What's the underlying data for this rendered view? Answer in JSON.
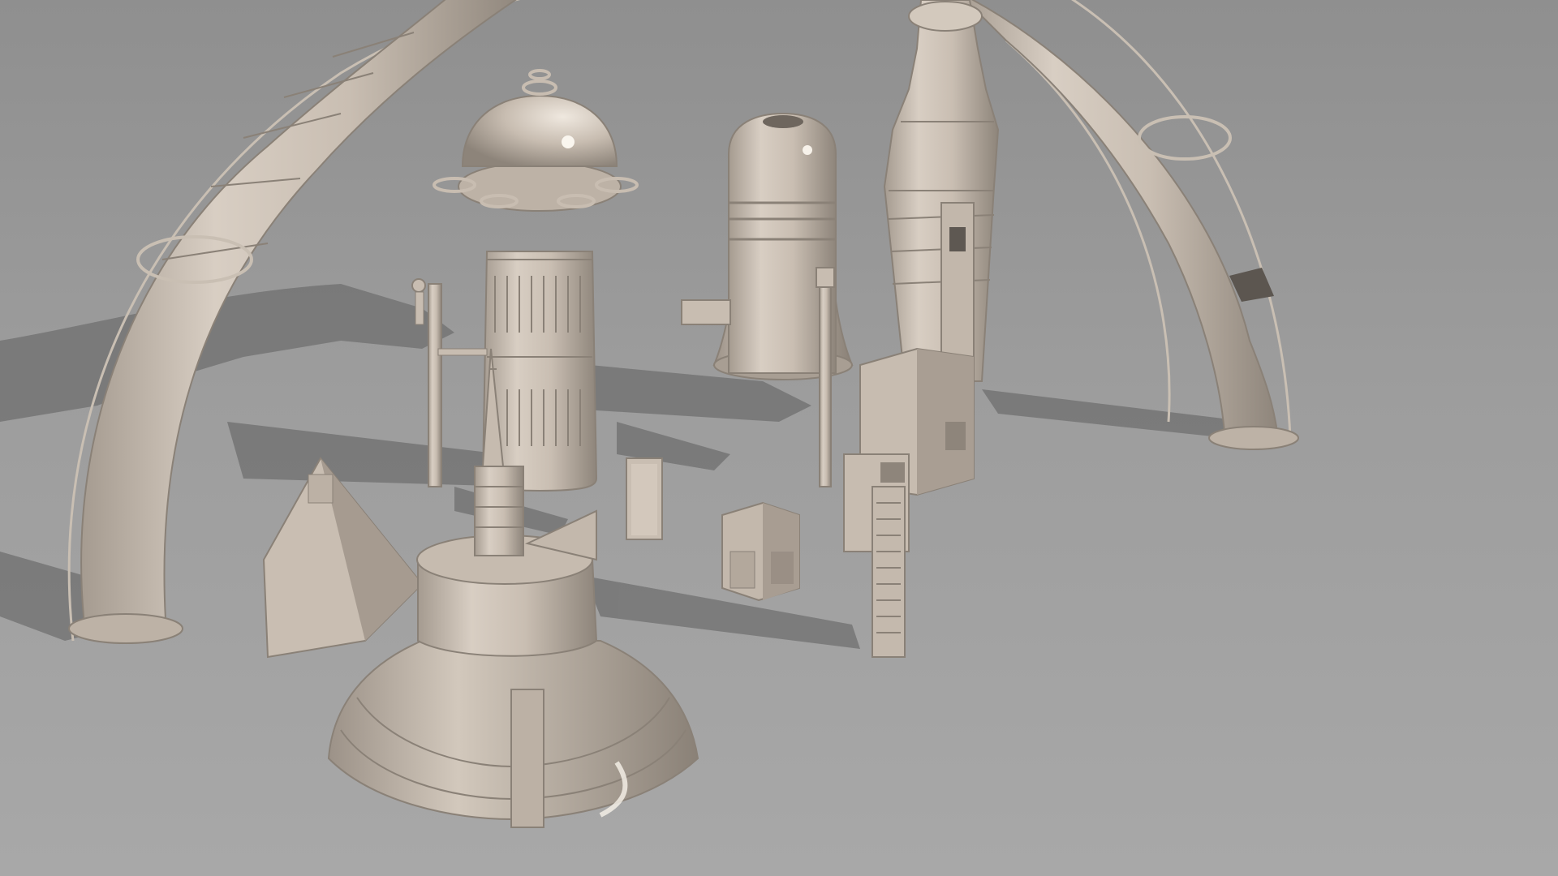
{
  "scene": {
    "kind": "3d-render",
    "background_color": "#9c9c9c",
    "floor_color": "#a6a6a6",
    "material_color": "#cdc2b6",
    "material_shadow": "#8e857b",
    "cast_shadow_color": "#6e6e6e",
    "highlight_color": "#f4efe8",
    "objects": [
      "arch",
      "domed-tower",
      "capsule-tower",
      "rocket-tower",
      "antenna-pole",
      "short-antenna",
      "pyramid",
      "spire-platform",
      "signboard",
      "crate",
      "control-block",
      "ladder-column"
    ]
  }
}
